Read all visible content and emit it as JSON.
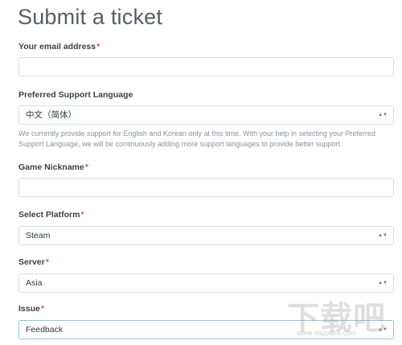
{
  "page": {
    "title": "Submit a ticket"
  },
  "form": {
    "required_mark": "*",
    "email": {
      "label": "Your email address",
      "value": ""
    },
    "language": {
      "label": "Preferred Support Language",
      "selected": "中文（简体）",
      "hint": "We currently provide support for English and Korean only at this time. With your help in selecting your Preferred Support Language, we will be continuously adding more support languages to provide better support."
    },
    "nickname": {
      "label": "Game Nickname",
      "value": ""
    },
    "platform": {
      "label": "Select Platform",
      "selected": "Steam"
    },
    "server": {
      "label": "Server",
      "selected": "Asia"
    },
    "issue": {
      "label": "Issue",
      "selected": "Feedback"
    },
    "caret_glyph": "▲▼"
  },
  "watermark": {
    "logo": "下载吧",
    "url": "www.xiazaiba.com"
  },
  "colors": {
    "required": "#d9534f",
    "focus_border": "#8cc8e6",
    "border": "#d8dcde"
  }
}
